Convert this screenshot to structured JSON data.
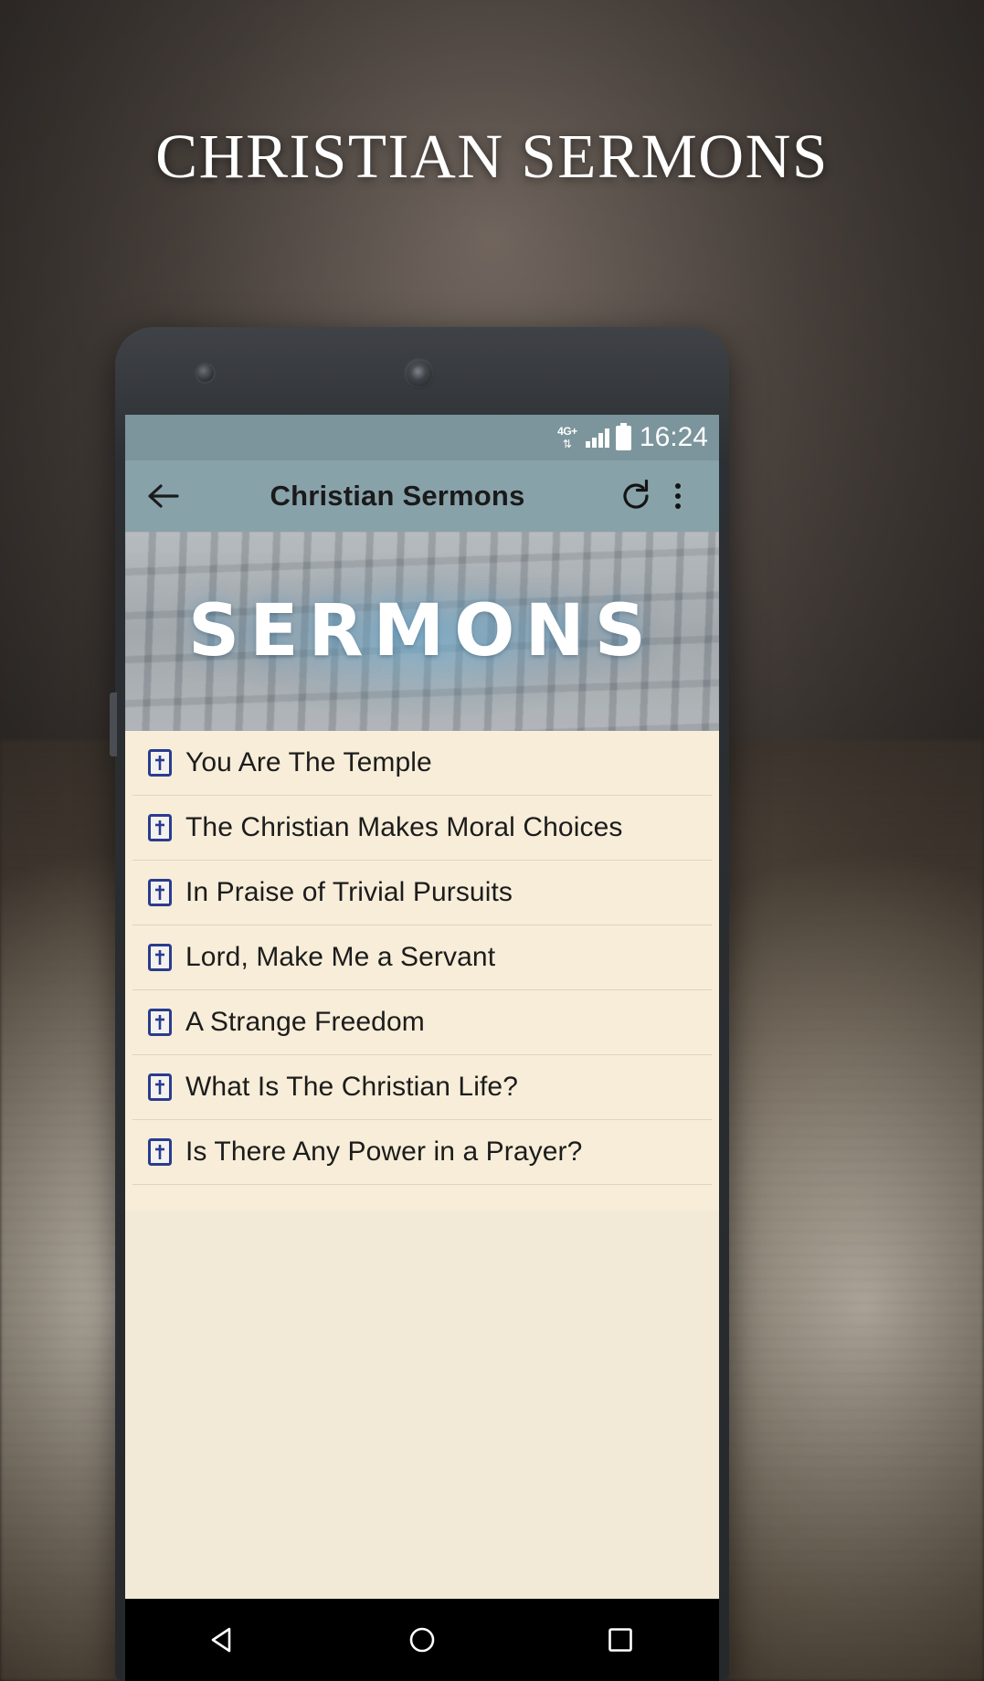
{
  "hero": {
    "title": "CHRISTIAN SERMONS"
  },
  "phone": {
    "statusbar": {
      "network_label": "4G+",
      "network_arrows": "⇅",
      "time": "16:24",
      "signal_icon": "signal-bars-icon",
      "battery_icon": "battery-icon"
    },
    "appbar": {
      "back_icon": "arrow-left-icon",
      "title": "Christian Sermons",
      "refresh_icon": "refresh-icon",
      "overflow_icon": "more-vertical-icon"
    },
    "banner": {
      "text": "SERMONS"
    },
    "list": {
      "item_icon": "bible-book-icon",
      "items": [
        {
          "label": "You Are The Temple"
        },
        {
          "label": "The Christian Makes Moral Choices"
        },
        {
          "label": "In Praise of Trivial Pursuits"
        },
        {
          "label": "Lord, Make Me a Servant"
        },
        {
          "label": "A Strange Freedom"
        },
        {
          "label": "What Is The Christian Life?"
        },
        {
          "label": "Is There Any Power in a Prayer?"
        }
      ]
    },
    "navbar": {
      "back_icon": "nav-back-triangle-icon",
      "home_icon": "nav-home-circle-icon",
      "recents_icon": "nav-recents-square-icon"
    }
  },
  "colors": {
    "statusbar": "#7c959c",
    "appbar": "#88a2aa",
    "list_bg": "#f7edd8",
    "divider": "#ded4bf",
    "text": "#1c1c1c"
  }
}
